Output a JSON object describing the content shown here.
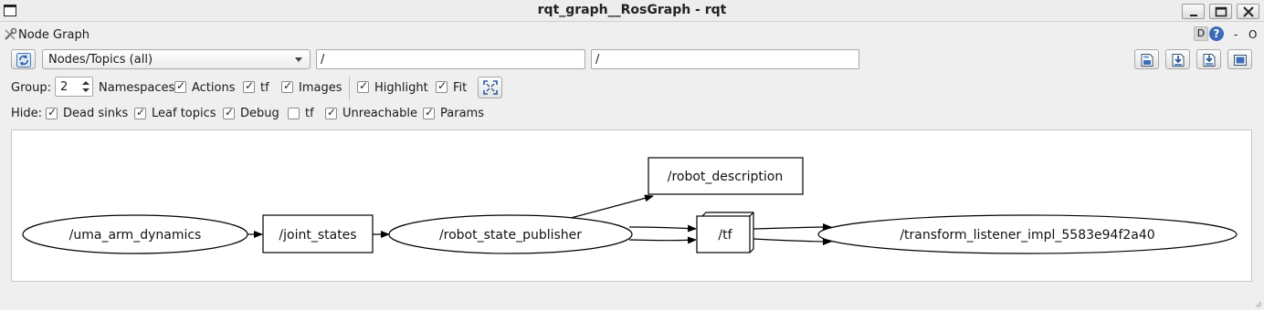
{
  "window": {
    "title": "rqt_graph__RosGraph - rqt"
  },
  "plugin": {
    "title": "Node Graph",
    "ctl_d": "D",
    "ctl_help": "?",
    "ctl_dash": "-",
    "ctl_o": "O"
  },
  "toolbar": {
    "mode_value": "Nodes/Topics (all)",
    "filter_include": "/",
    "filter_exclude": "/"
  },
  "options": {
    "group_label": "Group:",
    "group_value": "2",
    "namespaces_label": "Namespaces",
    "actions_label": "Actions",
    "tf_label": "tf",
    "images_label": "Images",
    "highlight_label": "Highlight",
    "fit_label": "Fit",
    "actions_checked": true,
    "tf_checked": true,
    "images_checked": true,
    "highlight_checked": true,
    "fit_checked": true
  },
  "hide": {
    "label": "Hide:",
    "dead_sinks_label": "Dead sinks",
    "leaf_topics_label": "Leaf topics",
    "debug_label": "Debug",
    "tf_label": "tf",
    "unreachable_label": "Unreachable",
    "params_label": "Params",
    "dead_sinks_checked": true,
    "leaf_topics_checked": true,
    "debug_checked": true,
    "tf_checked": false,
    "unreachable_checked": true,
    "params_checked": true
  },
  "graph": {
    "nodes": {
      "uma_arm_dynamics": "/uma_arm_dynamics",
      "joint_states": "/joint_states",
      "robot_state_publisher": "/robot_state_publisher",
      "robot_description": "/robot_description",
      "tf": "/tf",
      "transform_listener": "/transform_listener_impl_5583e94f2a40"
    }
  },
  "icons": {
    "refresh": "refresh-icon",
    "load": "load-dot-icon",
    "save_dot": "save-dot-icon",
    "save_svg": "save-svg-icon",
    "screenshot": "screenshot-icon",
    "fit": "fit-in-view-icon"
  }
}
